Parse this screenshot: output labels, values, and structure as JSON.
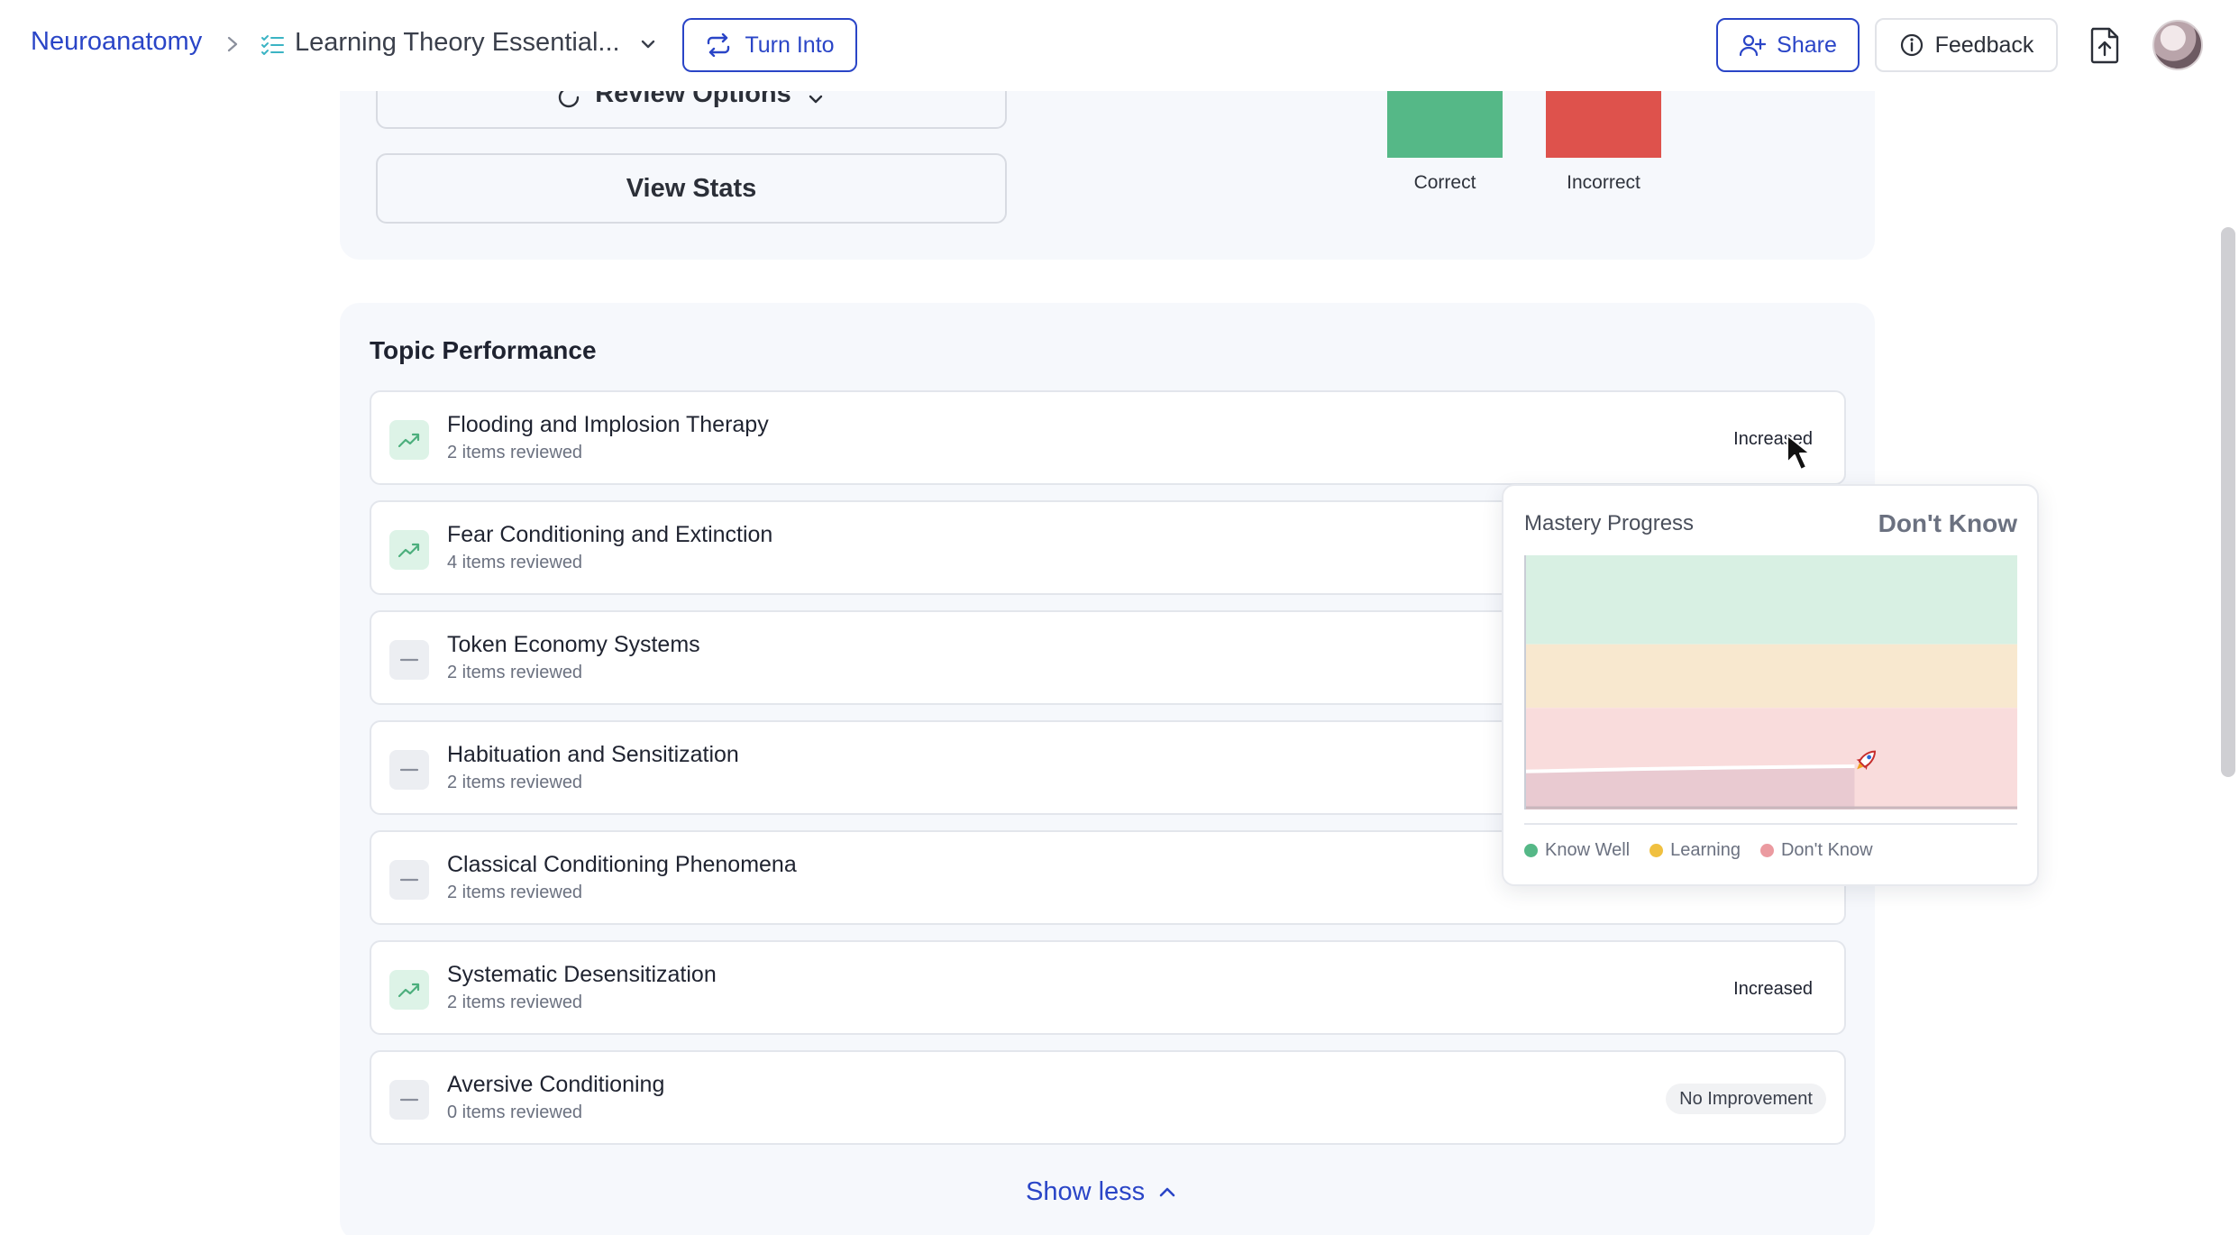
{
  "header": {
    "breadcrumb_root": "Neuroanatomy",
    "document_title": "Learning Theory Essential...",
    "turn_into_label": "Turn Into",
    "share_label": "Share",
    "feedback_label": "Feedback",
    "icons": {
      "separator": "chevron-right-icon",
      "document": "checklist-icon",
      "dropdown": "chevron-down-icon",
      "turn_into": "repeat-icon",
      "share": "user-plus-icon",
      "feedback": "info-icon",
      "export": "file-upload-icon",
      "avatar": "avatar"
    }
  },
  "top_card": {
    "review_options_label": "Review Options",
    "view_stats_label": "View Stats",
    "bars": [
      {
        "label": "Correct",
        "color": "#55b887"
      },
      {
        "label": "Incorrect",
        "color": "#de524c"
      }
    ]
  },
  "topic_performance": {
    "title": "Topic Performance",
    "rows": [
      {
        "name": "Flooding and Implosion Therapy",
        "sub": "2 items reviewed",
        "status": "Increased",
        "trend": "up"
      },
      {
        "name": "Fear Conditioning and Extinction",
        "sub": "4 items reviewed",
        "status": "",
        "trend": "up"
      },
      {
        "name": "Token Economy Systems",
        "sub": "2 items reviewed",
        "status": "",
        "trend": "flat"
      },
      {
        "name": "Habituation and Sensitization",
        "sub": "2 items reviewed",
        "status": "",
        "trend": "flat"
      },
      {
        "name": "Classical Conditioning Phenomena",
        "sub": "2 items reviewed",
        "status": "",
        "trend": "flat"
      },
      {
        "name": "Systematic Desensitization",
        "sub": "2 items reviewed",
        "status": "Increased",
        "trend": "up"
      },
      {
        "name": "Aversive Conditioning",
        "sub": "0 items reviewed",
        "status": "No Improvement",
        "trend": "flat"
      }
    ],
    "show_less_label": "Show less"
  },
  "mastery_popover": {
    "title": "Mastery Progress",
    "current_level": "Don't Know",
    "legend": [
      {
        "label": "Know Well",
        "color": "#55b887"
      },
      {
        "label": "Learning",
        "color": "#f0c040"
      },
      {
        "label": "Don't Know",
        "color": "#eb9aa0"
      }
    ],
    "zones": [
      {
        "name": "Know Well",
        "color": "#d8f0e3",
        "from": 0.65,
        "to": 1.0
      },
      {
        "name": "Learning",
        "color": "#f8e8cf",
        "from": 0.4,
        "to": 0.65
      },
      {
        "name": "Don't Know",
        "color": "#f9dcdc",
        "from": 0.0,
        "to": 0.4
      }
    ],
    "progress": 0.17,
    "marker_icon": "rocket-icon"
  },
  "colors": {
    "accent": "#2a45c7",
    "panel_bg": "#f6f8fc",
    "trend_up": "#4caf7d"
  }
}
